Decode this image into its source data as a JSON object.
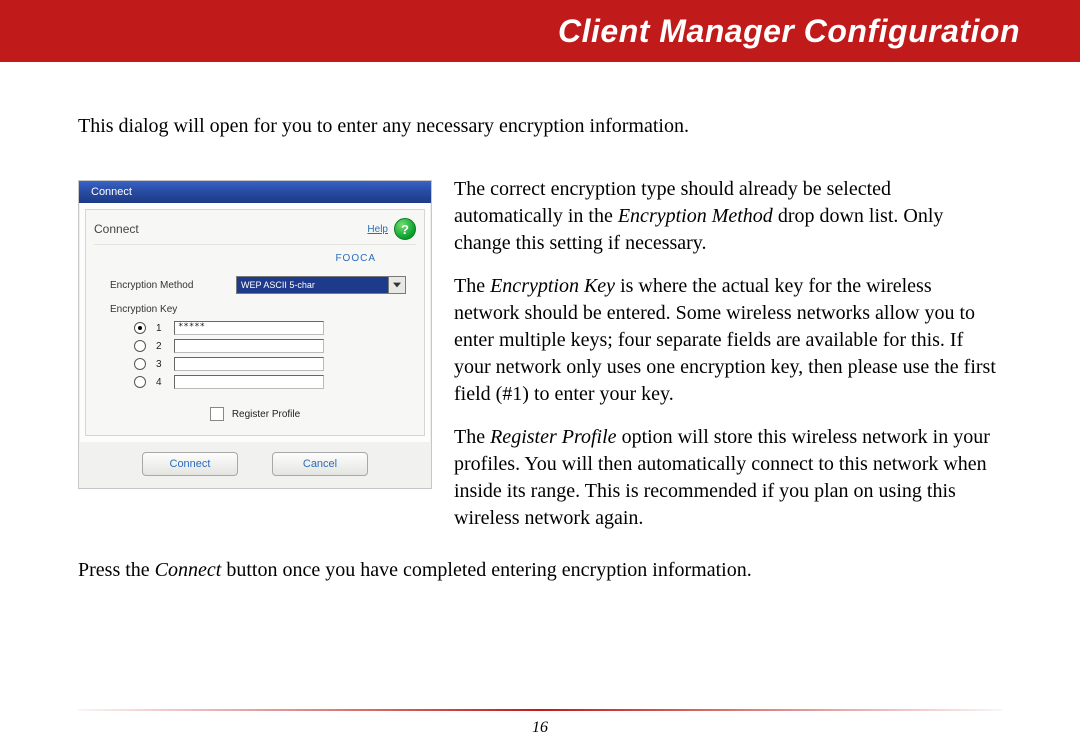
{
  "header": {
    "title": "Client Manager Configuration"
  },
  "intro": "This dialog will open for you to enter any necessary encryption information.",
  "dialog": {
    "titlebar": "Connect",
    "panel_title": "Connect",
    "help_label": "Help",
    "help_glyph": "?",
    "ssid": "FOOCA",
    "encryption_method_label": "Encryption Method",
    "encryption_method_value": "WEP ASCII 5-char",
    "encryption_key_label": "Encryption Key",
    "keys": [
      {
        "num": "1",
        "value": "*****",
        "selected": true
      },
      {
        "num": "2",
        "value": "",
        "selected": false
      },
      {
        "num": "3",
        "value": "",
        "selected": false
      },
      {
        "num": "4",
        "value": "",
        "selected": false
      }
    ],
    "register_profile_label": "Register Profile",
    "connect_btn": "Connect",
    "cancel_btn": "Cancel"
  },
  "body": {
    "p1a": "The correct encryption type should already be selected automatically in the ",
    "p1_em": "Encryption Method",
    "p1b": " drop down list.  Only change this setting if necessary.",
    "p2a": "The ",
    "p2_em": "Encryption Key",
    "p2b": " is where the actual key for the wireless network should be entered.  Some wireless networks allow you to enter multiple keys; four separate fields are available for this.  If your network only uses one encryption key, then please use the first field (#1) to enter your key.",
    "p3a": "The ",
    "p3_em": "Register Profile",
    "p3b": " option will store this wireless network in your profiles.  You will then automatically connect to this network when inside its range.  This is recommended if you plan on using this wireless network again."
  },
  "after_a": "Press the ",
  "after_em": "Connect",
  "after_b": " button once you have completed entering encryption information.",
  "page_number": "16"
}
